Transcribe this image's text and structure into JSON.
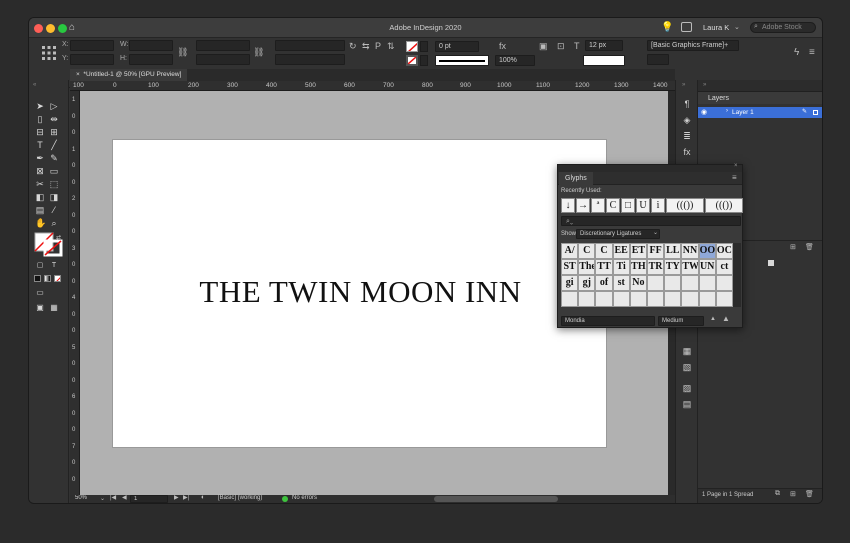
{
  "app": {
    "title": "Adobe InDesign 2020",
    "user": "Laura K",
    "stock_search_placeholder": "Adobe Stock"
  },
  "control_bar": {
    "x_label": "X:",
    "y_label": "Y:",
    "w_label": "W:",
    "h_label": "H:",
    "stroke_weight": "0 pt",
    "scale": "100%",
    "font_size": "12 px",
    "object_style": "[Basic Graphics Frame]+"
  },
  "document": {
    "tab_label": "*Untitled-1 @ 50% [GPU Preview]",
    "headline": "THE TWIN MOON INN"
  },
  "ruler": {
    "h_ticks": [
      "100",
      "0",
      "100",
      "200",
      "300",
      "400",
      "500",
      "600",
      "700",
      "800",
      "900",
      "1000",
      "1100",
      "1200",
      "1300",
      "1400"
    ],
    "v_ticks": [
      "1",
      "0",
      "0",
      "1",
      "0",
      "0",
      "2",
      "0",
      "0",
      "3",
      "0",
      "0",
      "4",
      "0",
      "0",
      "5",
      "0",
      "0",
      "6",
      "0",
      "0",
      "7",
      "0",
      "0"
    ]
  },
  "status": {
    "zoom": "50%",
    "page": "1",
    "preflight_profile": "[Basic] (working)",
    "errors": "No errors"
  },
  "layers_panel": {
    "title": "Layers",
    "layer_name": "Layer 1",
    "footer": "1 Page in 1 Spread",
    "layer_color": "#3b6fd8"
  },
  "glyphs_panel": {
    "title": "Glyphs",
    "recently_used_label": "Recently Used:",
    "recent": [
      "↓",
      "→",
      "ª",
      "C",
      "□",
      "U",
      "i",
      "((())",
      "((())"
    ],
    "show_label": "Show",
    "show_value": "Discretionary Ligatures",
    "grid": [
      [
        "A/",
        "C",
        "C",
        "EE",
        "ET",
        "FF",
        "LL",
        "NN",
        "OO",
        "OC"
      ],
      [
        "ST",
        "The",
        "TT",
        "Ti",
        "TH",
        "TR",
        "TY",
        "TW",
        "UN",
        "ct"
      ],
      [
        "gi",
        "gj",
        "of",
        "st",
        "No",
        "",
        "",
        "",
        "",
        ""
      ],
      [
        "",
        "",
        "",
        "",
        "",
        "",
        "",
        "",
        "",
        ""
      ]
    ],
    "font": "Mondia",
    "style": "Medium"
  },
  "colors": {
    "accent": "#3b6fd8",
    "ok": "#3ec43e",
    "close": "#ff5f57",
    "min": "#febc2e",
    "max": "#28c840",
    "selected_cell": "#8fa8d8"
  }
}
